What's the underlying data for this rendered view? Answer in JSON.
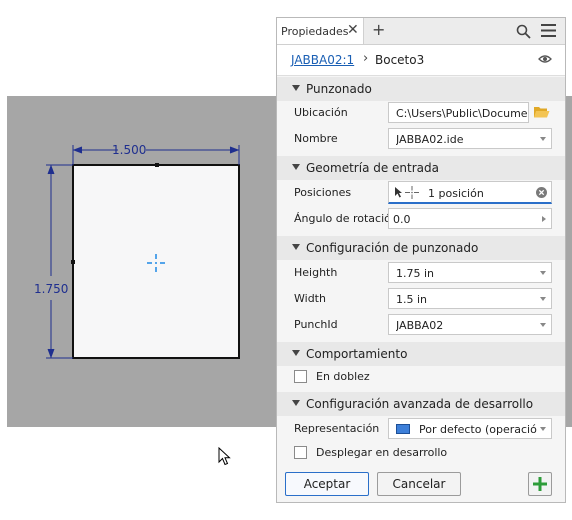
{
  "sketch": {
    "width_dim": "1.500",
    "height_dim": "1.750"
  },
  "panel": {
    "title": "Propiedades",
    "close_glyph": "✕",
    "add_glyph": "+",
    "breadcrumb": {
      "link": "JABBA02:1",
      "separator": "›",
      "current": "Boceto3"
    },
    "sections": {
      "punzonado": "Punzonado",
      "geometria": "Geometría de entrada",
      "config": "Configuración de punzonado",
      "comportamiento": "Comportamiento",
      "avanzada": "Configuración avanzada de desarrollo"
    },
    "fields": {
      "ubicacion": {
        "label": "Ubicación",
        "value": "C:\\Users\\Public\\Documents\\"
      },
      "nombre": {
        "label": "Nombre",
        "value": "JABBA02.ide"
      },
      "posiciones": {
        "label": "Posiciones",
        "value": "1 posición"
      },
      "angulo": {
        "label": "Ángulo de rotación",
        "value": "0.0"
      },
      "heighth": {
        "label": "Heighth",
        "value": "1.75 in"
      },
      "width": {
        "label": "Width",
        "value": "1.5 in"
      },
      "punchid": {
        "label": "PunchId",
        "value": "JABBA02"
      },
      "representacion": {
        "label": "Representación",
        "value": "Por defecto (operació..."
      }
    },
    "checkboxes": {
      "en_doblez": {
        "label": "En doblez",
        "checked": false
      },
      "desplegar": {
        "label": "Desplegar en desarrollo",
        "checked": false
      }
    },
    "buttons": {
      "accept": "Aceptar",
      "cancel": "Cancelar"
    }
  },
  "colors": {
    "canvas": "#a6a6a6",
    "dimension": "#1f2f8f",
    "accent_blue": "#1a5fb4",
    "center_mark": "#1e88e5",
    "add_green": "#2e9c3a",
    "folder": "#e0a826"
  },
  "icons": [
    "close-icon",
    "plus-icon",
    "search-icon",
    "menu-icon",
    "eye-icon",
    "folder-icon",
    "select-arrow-icon",
    "point-icon",
    "clear-icon",
    "representation-icon",
    "add-icon",
    "mouse-cursor-icon"
  ]
}
